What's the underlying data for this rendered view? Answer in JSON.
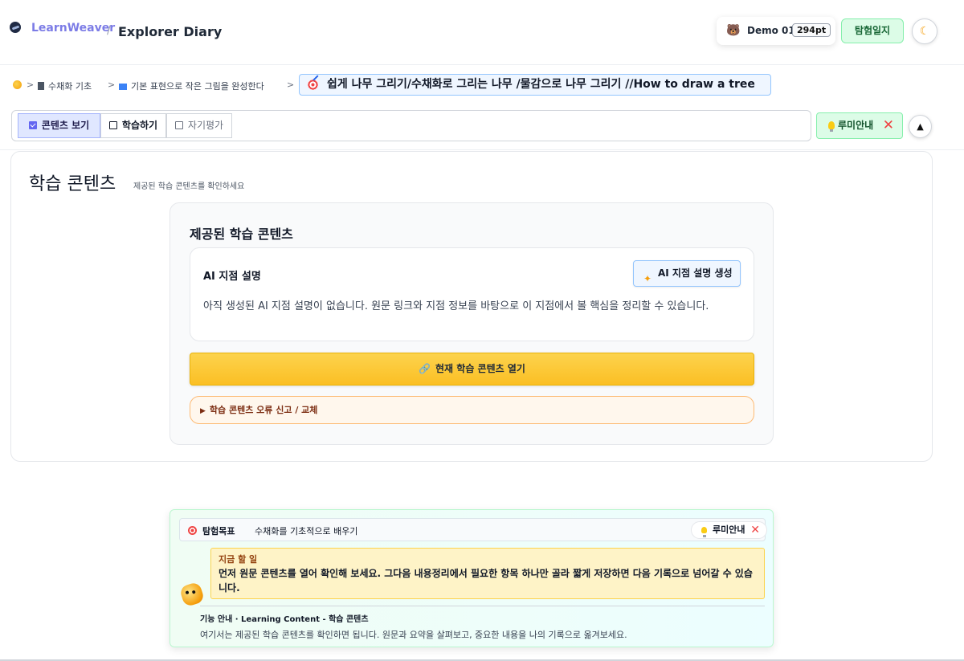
{
  "header": {
    "brand": "LearnWeaver",
    "separator": "/",
    "page_name": "Explorer Diary",
    "user_name": "Demo 01",
    "user_points": "294pt",
    "journal_button": "탐험일지",
    "theme_icon": "moon-icon"
  },
  "breadcrumb": {
    "sep": ">",
    "items": [
      "수채화 기초",
      "기본 표현으로 작은 그림을 완성한다"
    ],
    "current": "쉽게 나무 그리기/수채화로 그리는 나무 /물감으로 나무 그리기 //How to draw a tree"
  },
  "tabs": [
    {
      "label": "콘텐츠 보기",
      "state": "active"
    },
    {
      "label": "학습하기",
      "state": "normal"
    },
    {
      "label": "자기평가",
      "state": "muted"
    }
  ],
  "lumi_guide": {
    "label": "루미안내",
    "close": "✕"
  },
  "collapse_icon": "▲",
  "section": {
    "title": "학습 콘텐츠",
    "subtitle": "제공된 학습 콘텐츠를 확인하세요"
  },
  "content": {
    "title": "제공된 학습 콘텐츠",
    "ai": {
      "title": "AI 지점 설명",
      "button": "AI 지점 설명 생성",
      "description": "아직 생성된 AI 지점 설명이 없습니다. 원문 링크와 지점 정보를 바탕으로 이 지점에서 볼 핵심을 정리할 수 있습니다."
    },
    "open_button": "현재 학습 콘텐츠 열기",
    "report": "학습 콘텐츠 오류 신고 / 교체"
  },
  "guide": {
    "goal_label": "탐험목표",
    "goal_text": "수채화를 기초적으로 배우기",
    "lumi_label": "루미안내",
    "todo_label": "지금 할 일",
    "todo_text": "먼저 원문 콘텐츠를 열어 확인해 보세요. 그다음 내용정리에서 필요한 항목 하나만 골라 짧게 저장하면 다음 기록으로 넘어갈 수 있습니다.",
    "feature_label": "기능 안내 · Learning Content - 학습 콘텐츠",
    "feature_text": "여기서는 제공된 학습 콘텐츠를 확인하면 됩니다. 원문과 요약을 살펴보고, 중요한 내용을 나의 기록으로 옮겨보세요."
  },
  "colors": {
    "accent": "#6366f1",
    "success_bg": "#dcfce7",
    "warning": "#fbbf24",
    "danger": "#ef4444"
  }
}
